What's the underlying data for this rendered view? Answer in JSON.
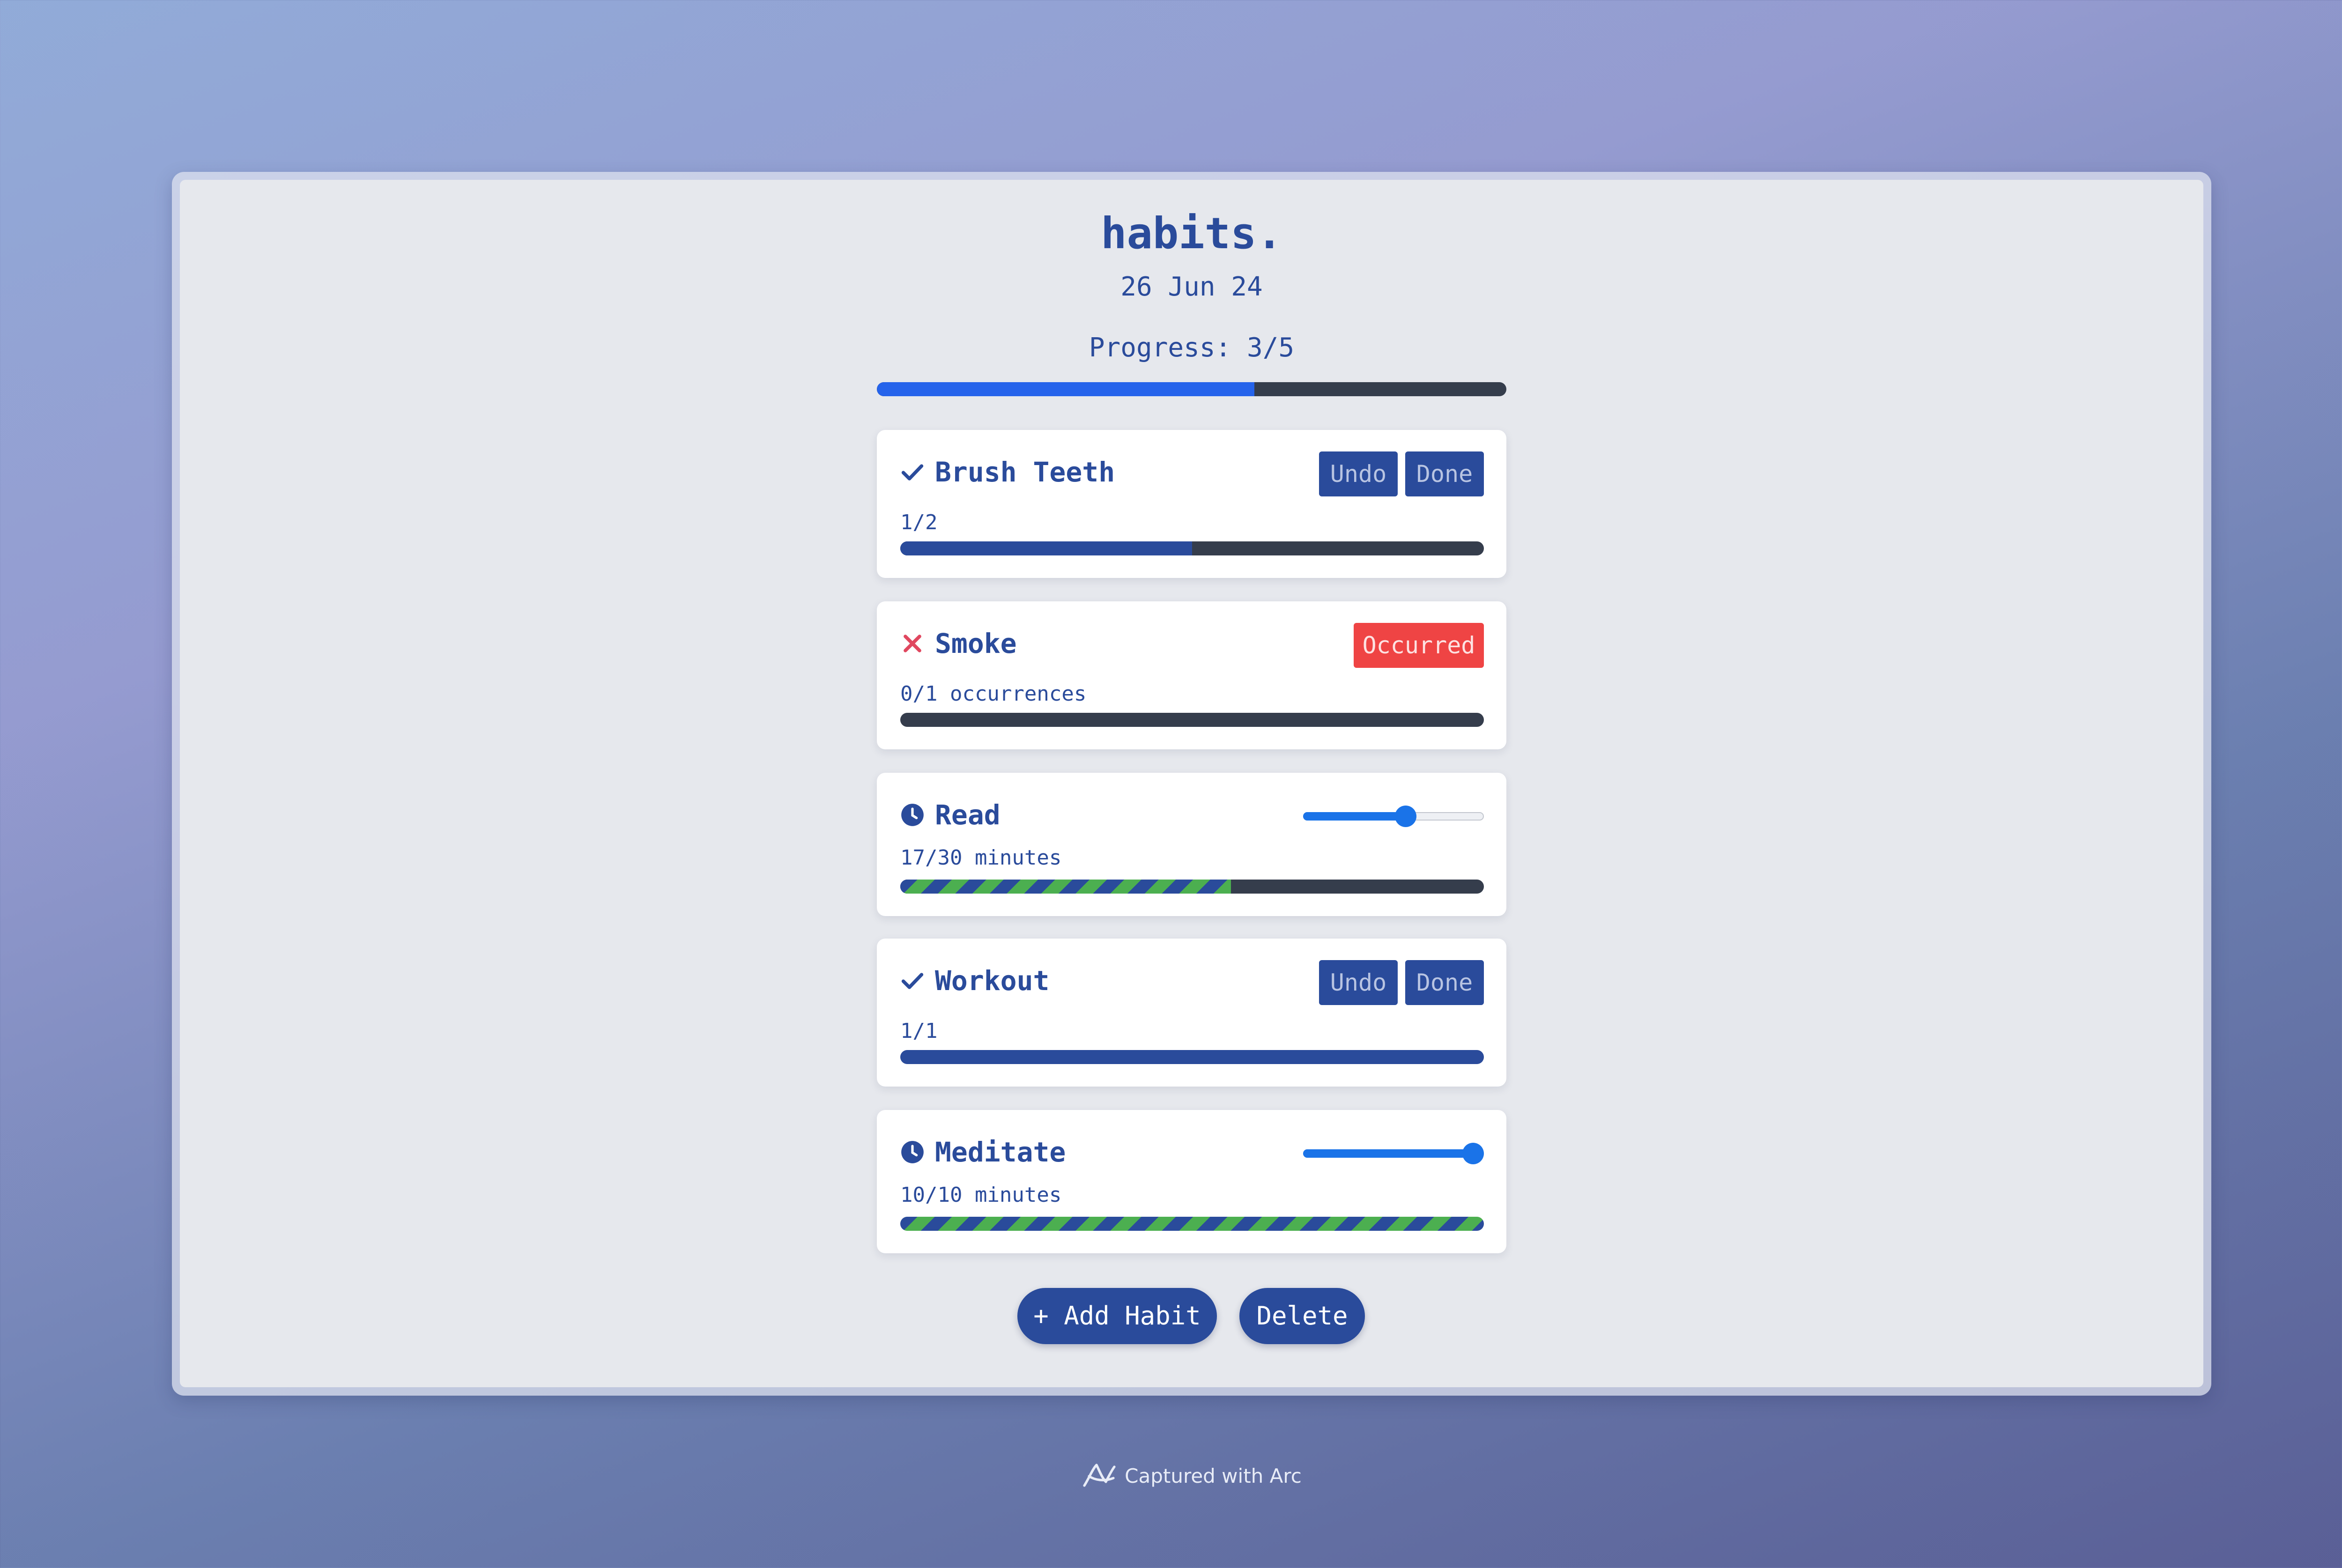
{
  "app": {
    "title": "habits.",
    "date": "26 Jun 24",
    "progress_label": "Progress: 3/5",
    "progress_fraction": 0.6
  },
  "habits": [
    {
      "name": "Brush Teeth",
      "status_icon": "check-icon",
      "subtext": "1/2",
      "progress_fraction": 0.5,
      "bar_style": "solid",
      "buttons": [
        "Undo",
        "Done"
      ]
    },
    {
      "name": "Smoke",
      "status_icon": "cross-icon",
      "subtext": "0/1 occurrences",
      "progress_fraction": 0,
      "bar_style": "solid",
      "buttons": [
        "Occurred"
      ]
    },
    {
      "name": "Read",
      "status_icon": "clock-icon",
      "subtext": "17/30 minutes",
      "progress_fraction": 0.567,
      "bar_style": "striped",
      "slider_value": 17,
      "slider_max": 30
    },
    {
      "name": "Workout",
      "status_icon": "check-icon",
      "subtext": "1/1",
      "progress_fraction": 1.0,
      "bar_style": "solid",
      "buttons": [
        "Undo",
        "Done"
      ]
    },
    {
      "name": "Meditate",
      "status_icon": "clock-icon",
      "subtext": "10/10 minutes",
      "progress_fraction": 1.0,
      "bar_style": "striped",
      "slider_value": 10,
      "slider_max": 10
    }
  ],
  "actions": {
    "add_habit": "+ Add Habit",
    "delete": "Delete"
  },
  "footer": {
    "text": "Captured with Arc",
    "icon": "arc-logo-icon"
  },
  "colors": {
    "primary": "#2a4b9b",
    "accent_blue": "#2563eb",
    "danger": "#ef4444",
    "stripe_green": "#4caf50",
    "track": "#353d4c",
    "slider_blue": "#1a73e8"
  }
}
